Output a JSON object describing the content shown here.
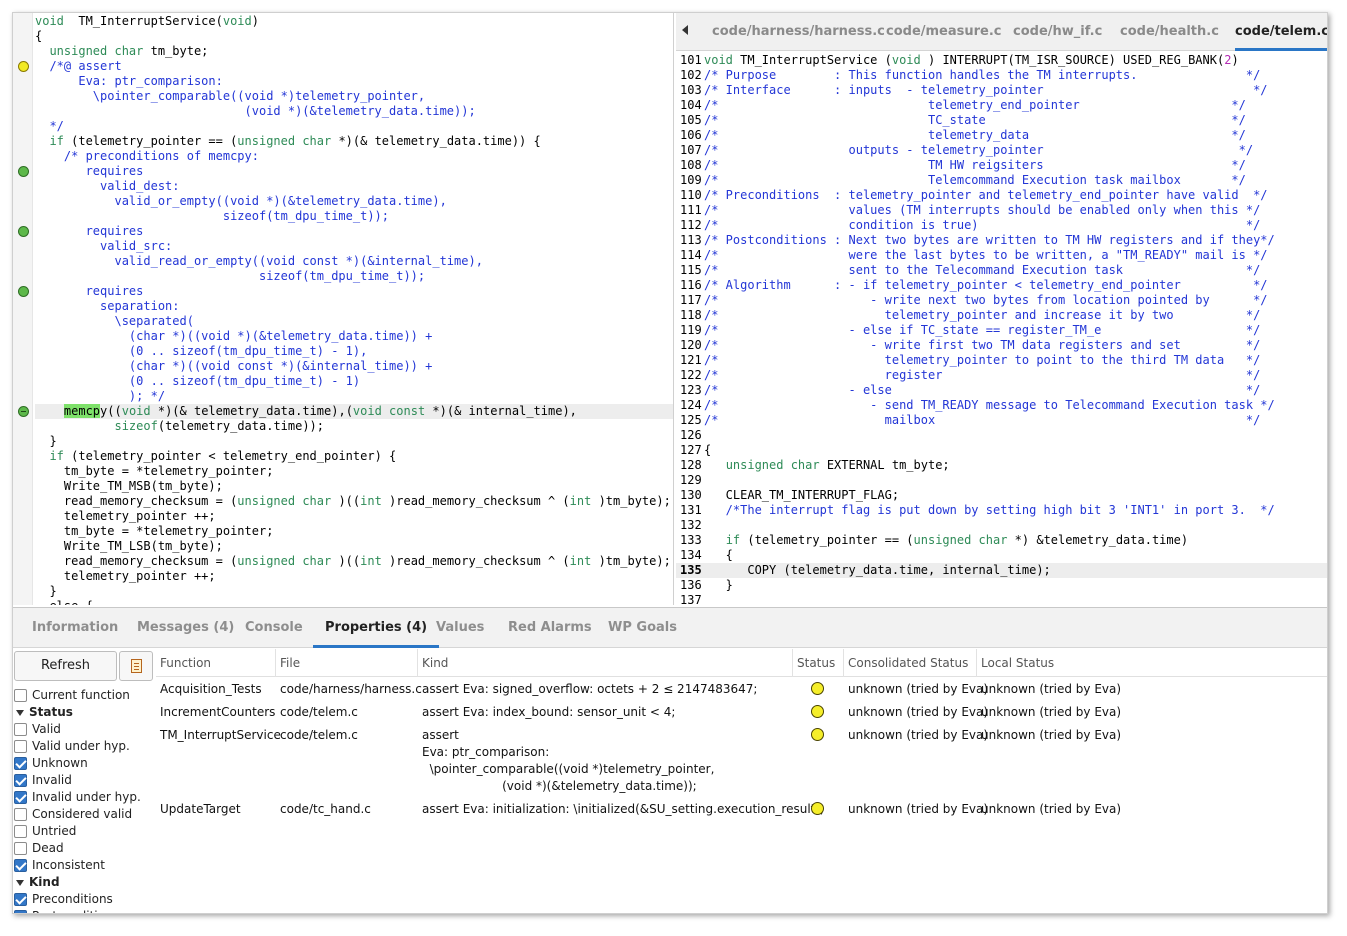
{
  "left_code": {
    "lines": [
      {
        "segs": [
          [
            "kw",
            "void"
          ],
          [
            "",
            "  TM_InterruptService("
          ],
          [
            "kw",
            "void"
          ],
          [
            "",
            ")"
          ]
        ]
      },
      {
        "segs": [
          [
            "",
            "{"
          ]
        ]
      },
      {
        "segs": [
          [
            "",
            "  "
          ],
          [
            "kw",
            "unsigned char"
          ],
          [
            "",
            " tm_byte;"
          ]
        ]
      },
      {
        "segs": [
          [
            "cm",
            "  /*@ assert"
          ]
        ],
        "mark": "yellow"
      },
      {
        "segs": [
          [
            "cm",
            "      Eva: ptr_comparison:"
          ]
        ]
      },
      {
        "segs": [
          [
            "cm",
            "        \\pointer_comparable((void *)telemetry_pointer,"
          ]
        ]
      },
      {
        "segs": [
          [
            "cm",
            "                             (void *)(&telemetry_data.time));"
          ]
        ]
      },
      {
        "segs": [
          [
            "cm",
            "  */"
          ]
        ]
      },
      {
        "segs": [
          [
            "",
            "  "
          ],
          [
            "kw",
            "if"
          ],
          [
            "",
            " (telemetry_pointer == ("
          ],
          [
            "kw",
            "unsigned char"
          ],
          [
            "",
            " *)(& telemetry_data.time)) {"
          ]
        ]
      },
      {
        "segs": [
          [
            "cm",
            "    /* preconditions of memcpy:"
          ]
        ]
      },
      {
        "segs": [
          [
            "cm",
            "       requires"
          ]
        ],
        "mark": "green"
      },
      {
        "segs": [
          [
            "cm",
            "         valid_dest:"
          ]
        ]
      },
      {
        "segs": [
          [
            "cm",
            "           valid_or_empty((void *)(&telemetry_data.time),"
          ]
        ]
      },
      {
        "segs": [
          [
            "cm",
            "                          sizeof(tm_dpu_time_t));"
          ]
        ]
      },
      {
        "segs": [
          [
            "cm",
            "       requires"
          ]
        ],
        "mark": "green"
      },
      {
        "segs": [
          [
            "cm",
            "         valid_src:"
          ]
        ]
      },
      {
        "segs": [
          [
            "cm",
            "           valid_read_or_empty((void const *)(&internal_time),"
          ]
        ]
      },
      {
        "segs": [
          [
            "cm",
            "                               sizeof(tm_dpu_time_t));"
          ]
        ]
      },
      {
        "segs": [
          [
            "cm",
            "       requires"
          ]
        ],
        "mark": "green"
      },
      {
        "segs": [
          [
            "cm",
            "         separation:"
          ]
        ]
      },
      {
        "segs": [
          [
            "cm",
            "           \\separated("
          ]
        ]
      },
      {
        "segs": [
          [
            "cm",
            "             (char *)((void *)(&telemetry_data.time)) +"
          ]
        ]
      },
      {
        "segs": [
          [
            "cm",
            "             (0 .. sizeof(tm_dpu_time_t) - 1),"
          ]
        ]
      },
      {
        "segs": [
          [
            "cm",
            "             (char *)((void const *)(&internal_time)) +"
          ]
        ]
      },
      {
        "segs": [
          [
            "cm",
            "             (0 .. sizeof(tm_dpu_time_t) - 1)"
          ]
        ]
      },
      {
        "segs": [
          [
            "cm",
            "             ); */"
          ]
        ]
      },
      {
        "segs": [
          [
            "",
            "    "
          ],
          [
            "hlword",
            "memcp"
          ],
          [
            "",
            "y(("
          ],
          [
            "kw",
            "void"
          ],
          [
            "",
            " *)(& telemetry_data.time),("
          ],
          [
            "kw",
            "void const"
          ],
          [
            "",
            " *)(& internal_time),"
          ]
        ],
        "mark": "green-minus",
        "hl": true
      },
      {
        "segs": [
          [
            "",
            "           "
          ],
          [
            "kw",
            "sizeof"
          ],
          [
            "",
            "(telemetry_data.time));"
          ]
        ]
      },
      {
        "segs": [
          [
            "",
            "  }"
          ]
        ]
      },
      {
        "segs": [
          [
            "",
            "  "
          ],
          [
            "kw",
            "if"
          ],
          [
            "",
            " (telemetry_pointer < telemetry_end_pointer) {"
          ]
        ]
      },
      {
        "segs": [
          [
            "",
            "    tm_byte = *telemetry_pointer;"
          ]
        ]
      },
      {
        "segs": [
          [
            "",
            "    Write_TM_MSB(tm_byte);"
          ]
        ]
      },
      {
        "segs": [
          [
            "",
            "    read_memory_checksum = ("
          ],
          [
            "kw",
            "unsigned char"
          ],
          [
            "",
            " )(("
          ],
          [
            "kw",
            "int"
          ],
          [
            "",
            " )read_memory_checksum ^ ("
          ],
          [
            "kw",
            "int"
          ],
          [
            "",
            " )tm_byte);"
          ]
        ]
      },
      {
        "segs": [
          [
            "",
            "    telemetry_pointer ++;"
          ]
        ]
      },
      {
        "segs": [
          [
            "",
            "    tm_byte = *telemetry_pointer;"
          ]
        ]
      },
      {
        "segs": [
          [
            "",
            "    Write_TM_LSB(tm_byte);"
          ]
        ]
      },
      {
        "segs": [
          [
            "",
            "    read_memory_checksum = ("
          ],
          [
            "kw",
            "unsigned char"
          ],
          [
            "",
            " )(("
          ],
          [
            "kw",
            "int"
          ],
          [
            "",
            " )read_memory_checksum ^ ("
          ],
          [
            "kw",
            "int"
          ],
          [
            "",
            " )tm_byte);"
          ]
        ]
      },
      {
        "segs": [
          [
            "",
            "    telemetry_pointer ++;"
          ]
        ]
      },
      {
        "segs": [
          [
            "",
            "  }"
          ]
        ]
      },
      {
        "segs": [
          [
            "",
            "  else {"
          ]
        ]
      }
    ]
  },
  "file_tabs": [
    {
      "label": "code/harness/harness.c",
      "active": false
    },
    {
      "label": "code/measure.c",
      "active": false
    },
    {
      "label": "code/hw_if.c",
      "active": false
    },
    {
      "label": "code/health.c",
      "active": false
    },
    {
      "label": "code/telem.c",
      "active": true
    }
  ],
  "right_code": {
    "current_line": 135,
    "lines": [
      {
        "n": "101",
        "segs": [
          [
            "kw",
            "void"
          ],
          [
            "",
            " TM_InterruptService ("
          ],
          [
            "kw",
            "void"
          ],
          [
            "",
            " ) INTERRUPT(TM_ISR_SOURCE) USED_REG_BANK("
          ],
          [
            "num",
            "2"
          ],
          [
            "",
            ")"
          ]
        ]
      },
      {
        "n": "102",
        "segs": [
          [
            "cm",
            "/* Purpose        : This function handles the TM interrupts.               */"
          ]
        ]
      },
      {
        "n": "103",
        "segs": [
          [
            "cm",
            "/* Interface      : inputs  - telemetry_pointer                             */"
          ]
        ]
      },
      {
        "n": "104",
        "segs": [
          [
            "cm",
            "/*                             telemetry_end_pointer                     */"
          ]
        ]
      },
      {
        "n": "105",
        "segs": [
          [
            "cm",
            "/*                             TC_state                                  */"
          ]
        ]
      },
      {
        "n": "106",
        "segs": [
          [
            "cm",
            "/*                             telemetry_data                            */"
          ]
        ]
      },
      {
        "n": "107",
        "segs": [
          [
            "cm",
            "/*                  outputs - telemetry_pointer                           */"
          ]
        ]
      },
      {
        "n": "108",
        "segs": [
          [
            "cm",
            "/*                             TM HW reigsiters                          */"
          ]
        ]
      },
      {
        "n": "109",
        "segs": [
          [
            "cm",
            "/*                             Telemcommand Execution task mailbox       */"
          ]
        ]
      },
      {
        "n": "110",
        "segs": [
          [
            "cm",
            "/* Preconditions  : telemetry_pointer and telemetry_end_pointer have valid  */"
          ]
        ]
      },
      {
        "n": "111",
        "segs": [
          [
            "cm",
            "/*                  values (TM interrupts should be enabled only when this */"
          ]
        ]
      },
      {
        "n": "112",
        "segs": [
          [
            "cm",
            "/*                  condition is true)                                     */"
          ]
        ]
      },
      {
        "n": "113",
        "segs": [
          [
            "cm",
            "/* Postconditions : Next two bytes are written to TM HW registers and if they*/"
          ]
        ]
      },
      {
        "n": "114",
        "segs": [
          [
            "cm",
            "/*                  were the last bytes to be written, a \"TM_READY\" mail is */"
          ]
        ]
      },
      {
        "n": "115",
        "segs": [
          [
            "cm",
            "/*                  sent to the Telecommand Execution task                 */"
          ]
        ]
      },
      {
        "n": "116",
        "segs": [
          [
            "cm",
            "/* Algorithm      : - if telemetry_pointer < telemetry_end_pointer          */"
          ]
        ]
      },
      {
        "n": "117",
        "segs": [
          [
            "cm",
            "/*                     - write next two bytes from location pointed by      */"
          ]
        ]
      },
      {
        "n": "118",
        "segs": [
          [
            "cm",
            "/*                       telemetry_pointer and increase it by two          */"
          ]
        ]
      },
      {
        "n": "119",
        "segs": [
          [
            "cm",
            "/*                  - else if TC_state == register_TM_e                    */"
          ]
        ]
      },
      {
        "n": "120",
        "segs": [
          [
            "cm",
            "/*                     - write first two TM data registers and set         */"
          ]
        ]
      },
      {
        "n": "121",
        "segs": [
          [
            "cm",
            "/*                       telemetry_pointer to point to the third TM data   */"
          ]
        ]
      },
      {
        "n": "122",
        "segs": [
          [
            "cm",
            "/*                       register                                          */"
          ]
        ]
      },
      {
        "n": "123",
        "segs": [
          [
            "cm",
            "/*                  - else                                                 */"
          ]
        ]
      },
      {
        "n": "124",
        "segs": [
          [
            "cm",
            "/*                     - send TM_READY message to Telecommand Execution task */"
          ]
        ]
      },
      {
        "n": "125",
        "segs": [
          [
            "cm",
            "/*                       mailbox                                           */"
          ]
        ]
      },
      {
        "n": "126",
        "segs": [
          [
            "",
            ""
          ]
        ]
      },
      {
        "n": "127",
        "segs": [
          [
            "",
            "{"
          ]
        ]
      },
      {
        "n": "128",
        "segs": [
          [
            "",
            "   "
          ],
          [
            "kw",
            "unsigned char"
          ],
          [
            "",
            " EXTERNAL tm_byte;"
          ]
        ]
      },
      {
        "n": "129",
        "segs": [
          [
            "",
            ""
          ]
        ]
      },
      {
        "n": "130",
        "segs": [
          [
            "",
            "   CLEAR_TM_INTERRUPT_FLAG;"
          ]
        ]
      },
      {
        "n": "131",
        "segs": [
          [
            "cm",
            "   /*The interrupt flag is put down by setting high bit 3 'INT1' in port 3.  */"
          ]
        ]
      },
      {
        "n": "132",
        "segs": [
          [
            "",
            ""
          ]
        ]
      },
      {
        "n": "133",
        "segs": [
          [
            "",
            "   "
          ],
          [
            "kw",
            "if"
          ],
          [
            "",
            " (telemetry_pointer == ("
          ],
          [
            "kw",
            "unsigned char"
          ],
          [
            "",
            " *) &telemetry_data.time)"
          ]
        ]
      },
      {
        "n": "134",
        "segs": [
          [
            "",
            "   {"
          ]
        ]
      },
      {
        "n": "135",
        "segs": [
          [
            "",
            "      COPY (telemetry_data.time, internal_time);"
          ]
        ]
      },
      {
        "n": "136",
        "segs": [
          [
            "",
            "   }"
          ]
        ]
      },
      {
        "n": "137",
        "segs": [
          [
            "",
            ""
          ]
        ]
      }
    ]
  },
  "bottom_tabs": [
    {
      "label": "Information",
      "active": false
    },
    {
      "label": "Messages (4)",
      "active": false
    },
    {
      "label": "Console",
      "active": false
    },
    {
      "label": "Properties (4)",
      "active": true
    },
    {
      "label": "Values",
      "active": false
    },
    {
      "label": "Red Alarms",
      "active": false
    },
    {
      "label": "WP Goals",
      "active": false
    }
  ],
  "side": {
    "refresh_label": "Refresh",
    "filters": [
      {
        "type": "check",
        "label": "Current function",
        "checked": false
      },
      {
        "type": "group",
        "label": "Status"
      },
      {
        "type": "check",
        "label": "Valid",
        "checked": false
      },
      {
        "type": "check",
        "label": "Valid under hyp.",
        "checked": false
      },
      {
        "type": "check",
        "label": "Unknown",
        "checked": true
      },
      {
        "type": "check",
        "label": "Invalid",
        "checked": true
      },
      {
        "type": "check",
        "label": "Invalid under hyp.",
        "checked": true
      },
      {
        "type": "check",
        "label": "Considered valid",
        "checked": false
      },
      {
        "type": "check",
        "label": "Untried",
        "checked": false
      },
      {
        "type": "check",
        "label": "Dead",
        "checked": false
      },
      {
        "type": "check",
        "label": "Inconsistent",
        "checked": true
      },
      {
        "type": "group",
        "label": "Kind"
      },
      {
        "type": "check",
        "label": "Preconditions",
        "checked": true
      },
      {
        "type": "check",
        "label": "Postconditions",
        "checked": true
      }
    ]
  },
  "table": {
    "columns": [
      "Function",
      "File",
      "Kind",
      "Status",
      "Consolidated Status",
      "Local Status"
    ],
    "rows": [
      {
        "function": "Acquisition_Tests",
        "file": "code/harness/harness.c",
        "kind": "assert Eva: signed_overflow: octets + 2 ≤ 2147483647;",
        "status": "unknown",
        "consolidated": "unknown (tried by Eva)",
        "local": "unknown (tried by Eva)"
      },
      {
        "function": "IncrementCounters",
        "file": "code/telem.c",
        "kind": "assert Eva: index_bound: sensor_unit < 4;",
        "status": "unknown",
        "consolidated": "unknown (tried by Eva)",
        "local": "unknown (tried by Eva)"
      },
      {
        "function": "TM_InterruptService",
        "file": "code/telem.c",
        "kind": "assert\nEva: ptr_comparison:\n  \\pointer_comparable((void *)telemetry_pointer,\n                     (void *)(&telemetry_data.time));",
        "status": "unknown",
        "consolidated": "unknown (tried by Eva)",
        "local": "unknown (tried by Eva)"
      },
      {
        "function": "UpdateTarget",
        "file": "code/tc_hand.c",
        "kind": "assert Eva: initialization: \\initialized(&SU_setting.execution_result);",
        "status": "unknown",
        "consolidated": "unknown (tried by Eva)",
        "local": "unknown (tried by Eva)"
      }
    ]
  }
}
